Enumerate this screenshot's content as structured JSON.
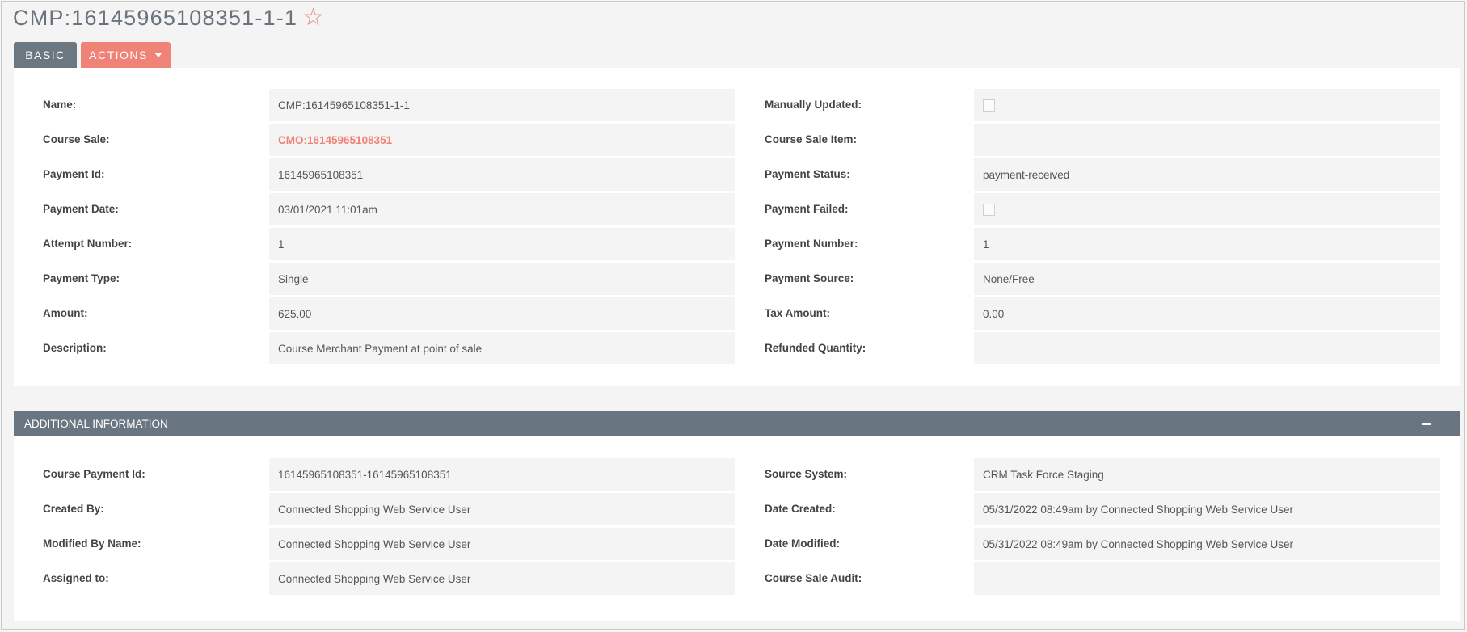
{
  "page": {
    "title": "CMP:16145965108351-1-1"
  },
  "tabs": {
    "basic": "BASIC",
    "actions": "ACTIONS"
  },
  "basic": {
    "left": [
      {
        "label": "Name:",
        "value": "CMP:16145965108351-1-1"
      },
      {
        "label": "Course Sale:",
        "value": "CMO:16145965108351"
      },
      {
        "label": "Payment Id:",
        "value": "16145965108351"
      },
      {
        "label": "Payment Date:",
        "value": "03/01/2021 11:01am"
      },
      {
        "label": "Attempt Number:",
        "value": "1"
      },
      {
        "label": "Payment Type:",
        "value": "Single"
      },
      {
        "label": "Amount:",
        "value": "625.00"
      },
      {
        "label": "Description:",
        "value": "Course Merchant Payment at point of sale"
      }
    ],
    "right": [
      {
        "label": "Manually Updated:",
        "checked": false
      },
      {
        "label": "Course Sale Item:",
        "value": ""
      },
      {
        "label": "Payment Status:",
        "value": "payment-received"
      },
      {
        "label": "Payment Failed:",
        "checked": false
      },
      {
        "label": "Payment Number:",
        "value": "1"
      },
      {
        "label": "Payment Source:",
        "value": "None/Free"
      },
      {
        "label": "Tax Amount:",
        "value": "0.00"
      },
      {
        "label": "Refunded Quantity:",
        "value": ""
      }
    ]
  },
  "additional": {
    "header": "ADDITIONAL INFORMATION",
    "left": [
      {
        "label": "Course Payment Id:",
        "value": "16145965108351-16145965108351"
      },
      {
        "label": "Created By:",
        "value": "Connected Shopping Web Service User"
      },
      {
        "label": "Modified By Name:",
        "value": "Connected Shopping Web Service User"
      },
      {
        "label": "Assigned to:",
        "value": "Connected Shopping Web Service User"
      }
    ],
    "right": [
      {
        "label": "Source System:",
        "value": "CRM Task Force Staging"
      },
      {
        "label": "Date Created:",
        "value": "05/31/2022 08:49am by Connected Shopping Web Service User"
      },
      {
        "label": "Date Modified:",
        "value": "05/31/2022 08:49am by Connected Shopping Web Service User"
      },
      {
        "label": "Course Sale Audit:",
        "value": ""
      }
    ]
  },
  "colors": {
    "accent": "#f08377",
    "tab_gray": "#6b7781",
    "header_bar": "#697580"
  },
  "icons": {
    "favorite": "star-outline-icon",
    "collapse": "minus-icon",
    "dropdown": "caret-down-icon"
  }
}
